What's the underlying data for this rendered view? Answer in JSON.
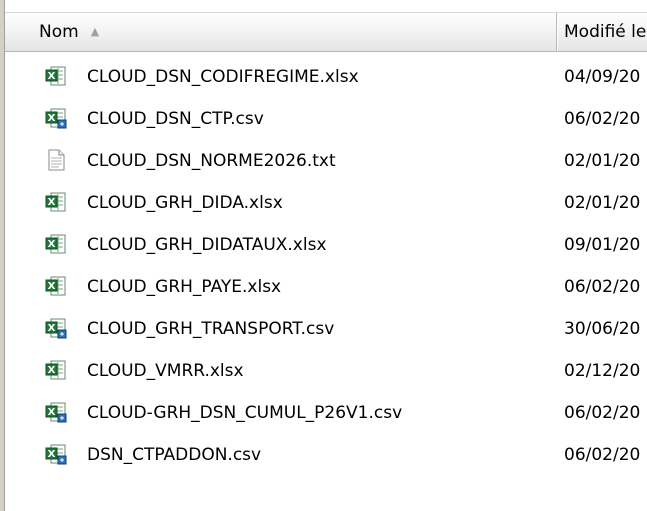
{
  "header": {
    "name_label": "Nom",
    "modified_label": "Modifié le"
  },
  "files": [
    {
      "name": "CLOUD_DSN_CODIFREGIME.xlsx",
      "date": "04/09/20",
      "icon": "excel-icon"
    },
    {
      "name": "CLOUD_DSN_CTP.csv",
      "date": "06/02/20",
      "icon": "csv-icon"
    },
    {
      "name": "CLOUD_DSN_NORME2026.txt",
      "date": "02/01/20",
      "icon": "text-file-icon"
    },
    {
      "name": "CLOUD_GRH_DIDA.xlsx",
      "date": "02/01/20",
      "icon": "excel-icon"
    },
    {
      "name": "CLOUD_GRH_DIDATAUX.xlsx",
      "date": "09/01/20",
      "icon": "excel-icon"
    },
    {
      "name": "CLOUD_GRH_PAYE.xlsx",
      "date": "06/02/20",
      "icon": "excel-icon"
    },
    {
      "name": "CLOUD_GRH_TRANSPORT.csv",
      "date": "30/06/20",
      "icon": "csv-icon"
    },
    {
      "name": "CLOUD_VMRR.xlsx",
      "date": "02/12/20",
      "icon": "excel-icon"
    },
    {
      "name": "CLOUD-GRH_DSN_CUMUL_P26V1.csv",
      "date": "06/02/20",
      "icon": "csv-icon"
    },
    {
      "name": "DSN_CTPADDON.csv",
      "date": "06/02/20",
      "icon": "csv-icon"
    }
  ],
  "colors": {
    "excel_green": "#1f7a3a",
    "header_border": "#b8b8b8"
  }
}
